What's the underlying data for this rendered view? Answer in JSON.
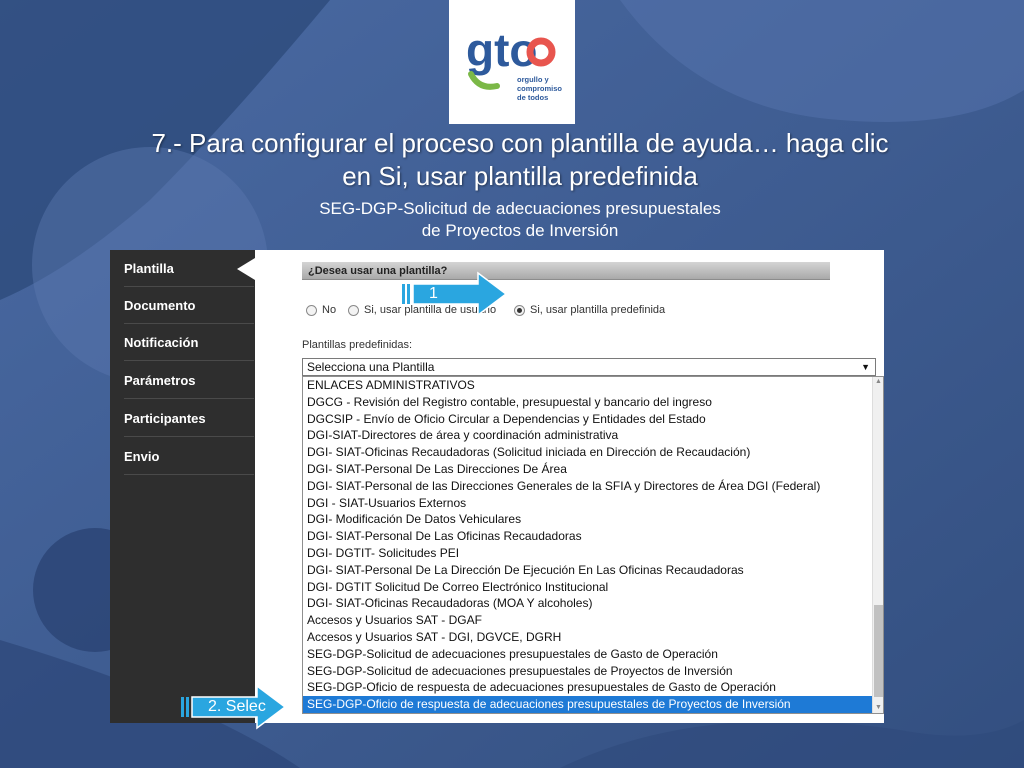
{
  "logo": {
    "mark": "gto",
    "tagline_1": "orgullo y",
    "tagline_2": "compromiso",
    "tagline_3": "de todos"
  },
  "headline": {
    "line1": "7.- Para configurar el proceso con plantilla de ayuda… haga clic",
    "line2": "en Si, usar plantilla predefinida"
  },
  "subheading": {
    "line1": "SEG-DGP-Solicitud de adecuaciones presupuestales",
    "line2": "de Proyectos de Inversión"
  },
  "sidebar": {
    "items": [
      {
        "label": "Plantilla",
        "active": true
      },
      {
        "label": "Documento"
      },
      {
        "label": "Notificación"
      },
      {
        "label": "Parámetros"
      },
      {
        "label": "Participantes"
      },
      {
        "label": "Envio"
      }
    ]
  },
  "form": {
    "section_title": "¿Desea usar una plantilla?",
    "radios": [
      {
        "label": "No",
        "checked": false
      },
      {
        "label": "Si, usar plantilla de usuario",
        "checked": false
      },
      {
        "label": "Si, usar plantilla predefinida",
        "checked": true
      }
    ],
    "plantillas_label": "Plantillas predefinidas:",
    "select_value": "Selecciona una Plantilla",
    "options": [
      "ENLACES ADMINISTRATIVOS",
      "DGCG - Revisión del Registro contable, presupuestal y bancario del ingreso",
      "DGCSIP - Envío de Oficio Circular a Dependencias y Entidades del Estado",
      "DGI-SIAT-Directores de área y coordinación administrativa",
      "DGI- SIAT-Oficinas Recaudadoras (Solicitud iniciada en Dirección de Recaudación)",
      "DGI- SIAT-Personal De Las Direcciones De Área",
      "DGI- SIAT-Personal de las Direcciones Generales de la SFIA y Directores de Área DGI (Federal)",
      "DGI - SIAT-Usuarios Externos",
      "DGI- Modificación De Datos Vehiculares",
      "DGI- SIAT-Personal De Las Oficinas Recaudadoras",
      "DGI- DGTIT- Solicitudes PEI",
      "DGI- SIAT-Personal De La Dirección De Ejecución En Las Oficinas Recaudadoras",
      "DGI- DGTIT Solicitud De Correo Electrónico Institucional",
      "DGI- SIAT-Oficinas Recaudadoras (MOA Y alcoholes)",
      "Accesos y Usuarios SAT - DGAF",
      "Accesos y Usuarios SAT - DGI, DGVCE, DGRH",
      "SEG-DGP-Solicitud de adecuaciones presupuestales de Gasto de Operación",
      "SEG-DGP-Solicitud de adecuaciones presupuestales de Proyectos de Inversión",
      "SEG-DGP-Oficio de respuesta de adecuaciones presupuestales de Gasto de Operación",
      "SEG-DGP-Oficio de respuesta de adecuaciones presupuestales de Proyectos de Inversión"
    ],
    "selected_option_index": 19
  },
  "callouts": {
    "step1": "1",
    "step2": "2. Selec"
  },
  "colors": {
    "background": "#3d5d94",
    "sidebar": "#2e2e2e",
    "selected_option": "#1e7ad6",
    "callout_arrow": "#2aa6e0"
  }
}
